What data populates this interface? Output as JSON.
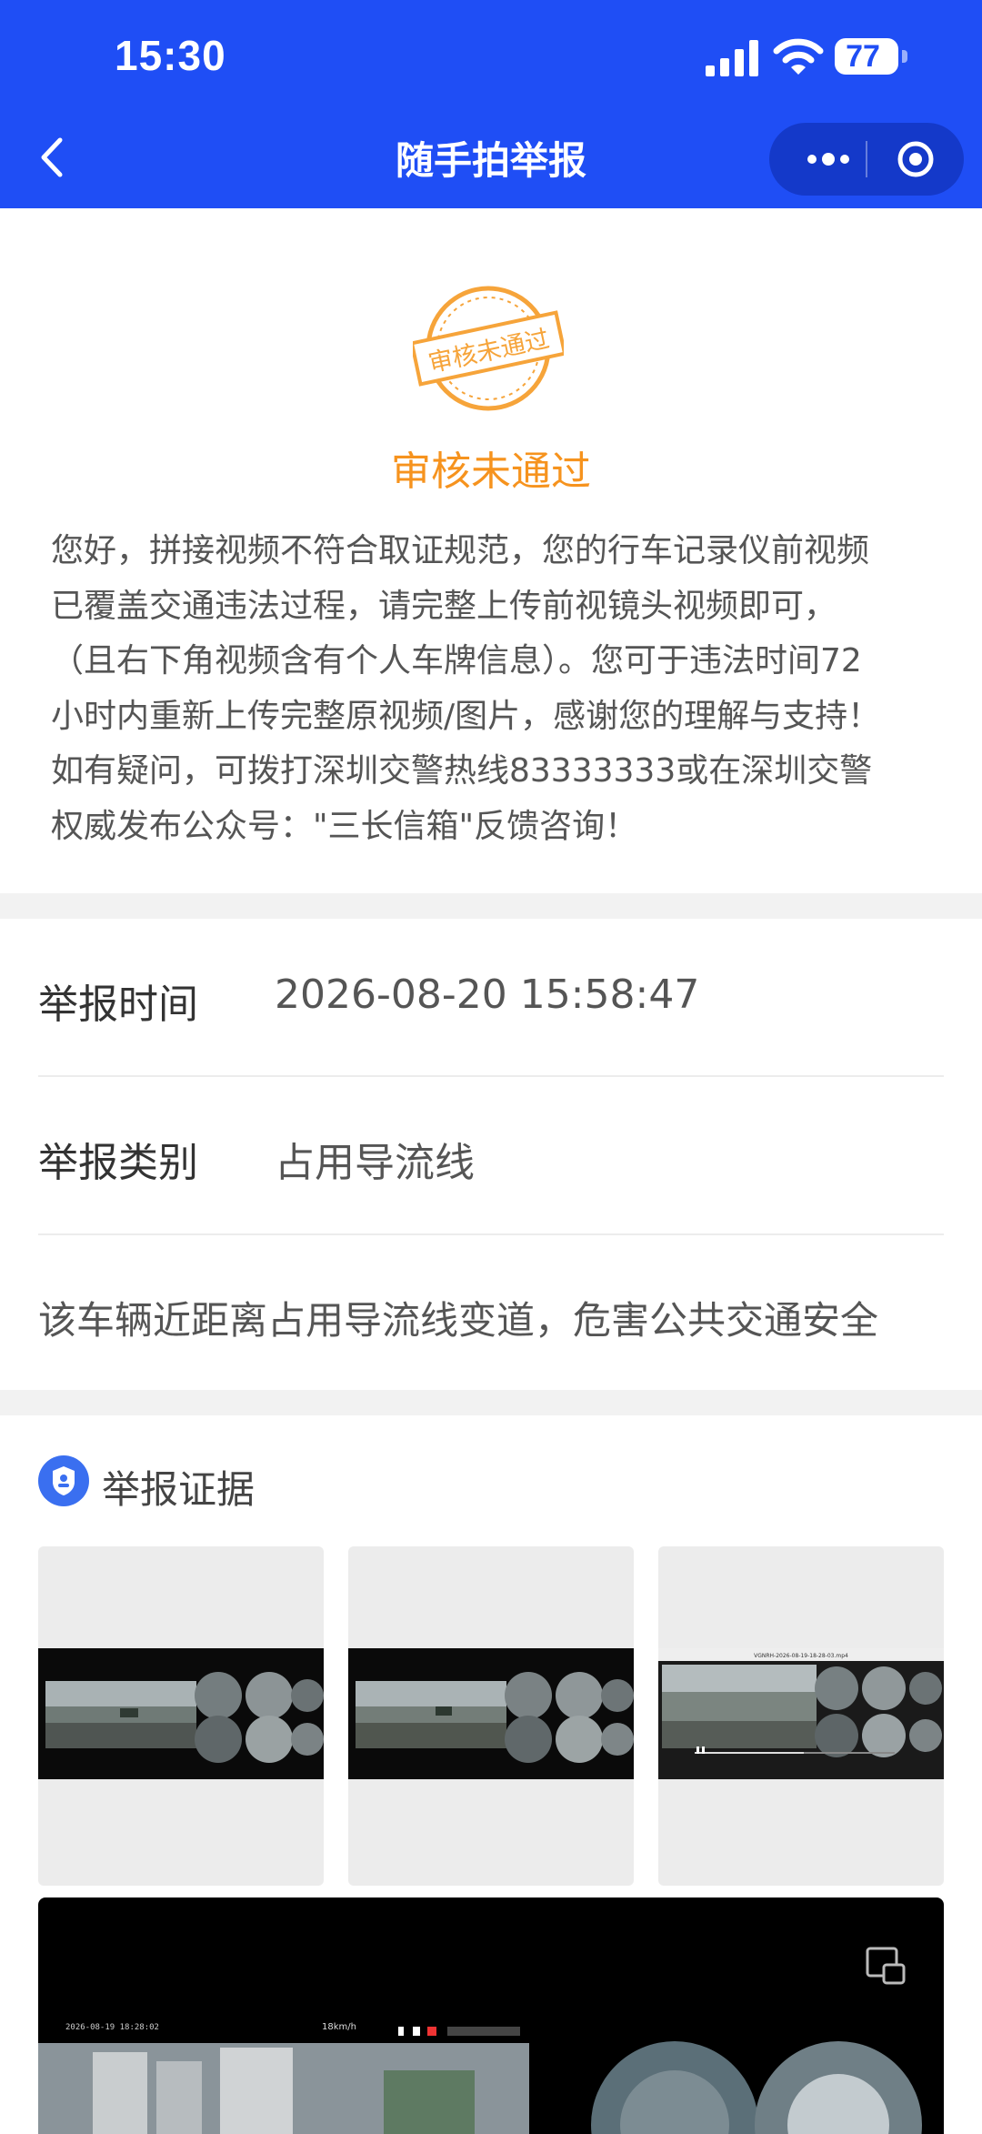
{
  "status_bar": {
    "time": "15:30",
    "battery": "77"
  },
  "nav": {
    "title": "随手拍举报"
  },
  "review": {
    "stamp_text": "审核未通过",
    "status": "审核未通过",
    "message_lines": [
      "您好，拼接视频不符合取证规范，您的行车记录仪前视频",
      "已覆盖交通违法过程，请完整上传前视镜头视频即可，",
      "（且右下角视频含有个人车牌信息）。您可于违法时间72",
      "小时内重新上传完整原视频/图片，感谢您的理解与支持！",
      "如有疑问，可拨打深圳交警热线83333333或在深圳交警",
      "权威发布公众号：\"三长信箱\"反馈咨询！"
    ]
  },
  "report": {
    "time_label": "举报时间",
    "time_value": "2026-08-20 15:58:47",
    "category_label": "举报类别",
    "category_value": "占用导流线",
    "description": "该车辆近距离占用导流线变道，危害公共交通安全"
  },
  "evidence": {
    "title": "举报证据",
    "thumb3_filename": "VGNRH-2026-08-19-18-28-03.mp4",
    "video_timestamp": "2026-08-19 18:28:02",
    "video_speed": "18km/h"
  },
  "colors": {
    "brand_blue": "#1f4ef5",
    "status_orange": "#f6931e"
  },
  "icons": [
    "back-icon",
    "more-icon",
    "close-mini-program-icon",
    "stamp-icon",
    "evidence-badge-icon",
    "pip-icon"
  ]
}
